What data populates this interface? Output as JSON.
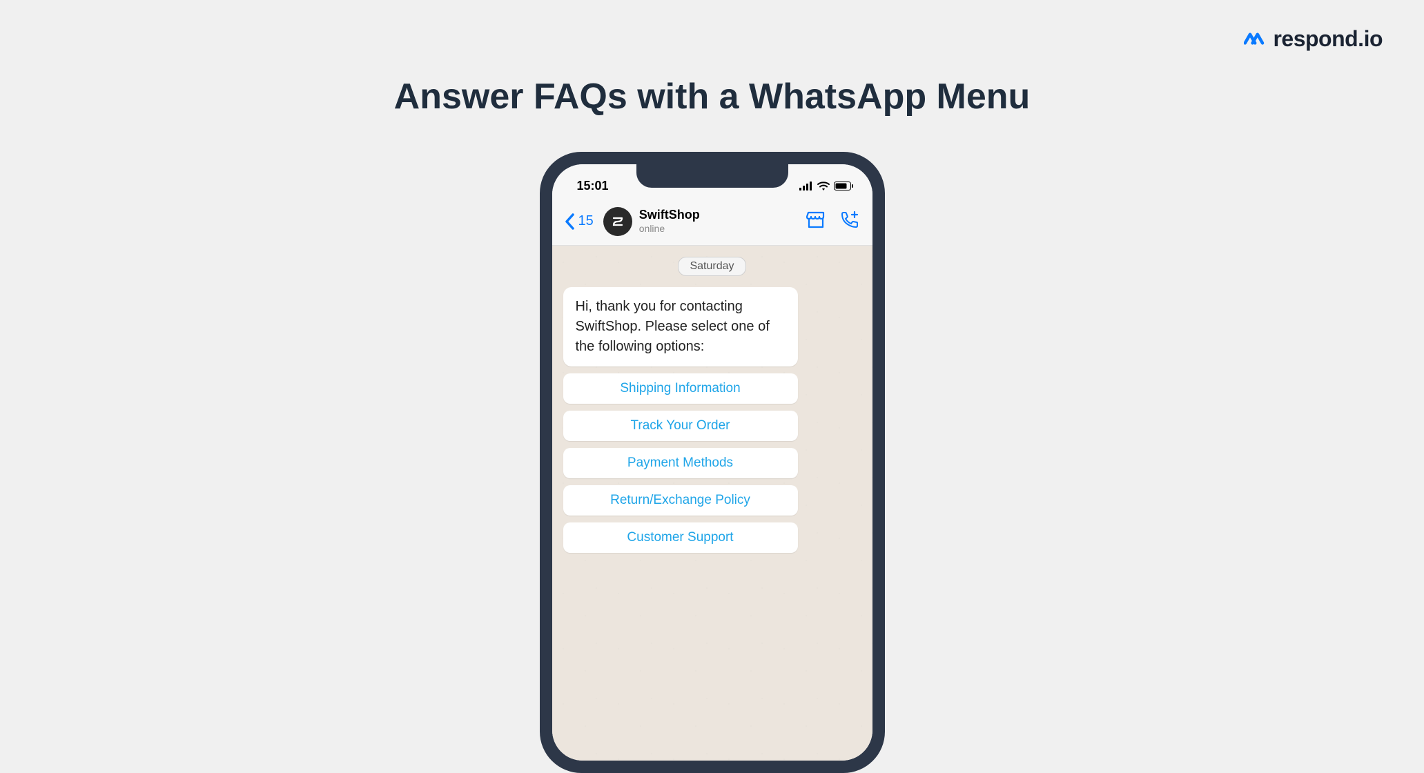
{
  "logo": {
    "text": "respond.io"
  },
  "heading": "Answer FAQs with a WhatsApp Menu",
  "phone": {
    "statusBar": {
      "time": "15:01"
    },
    "chatHeader": {
      "backCount": "15",
      "contactName": "SwiftShop",
      "contactStatus": "online"
    },
    "chat": {
      "dateLabel": "Saturday",
      "message": "Hi, thank you for contacting SwiftShop. Please select one of the following options:",
      "options": [
        "Shipping Information",
        "Track Your Order",
        "Payment Methods",
        "Return/Exchange Policy",
        "Customer Support"
      ]
    }
  }
}
